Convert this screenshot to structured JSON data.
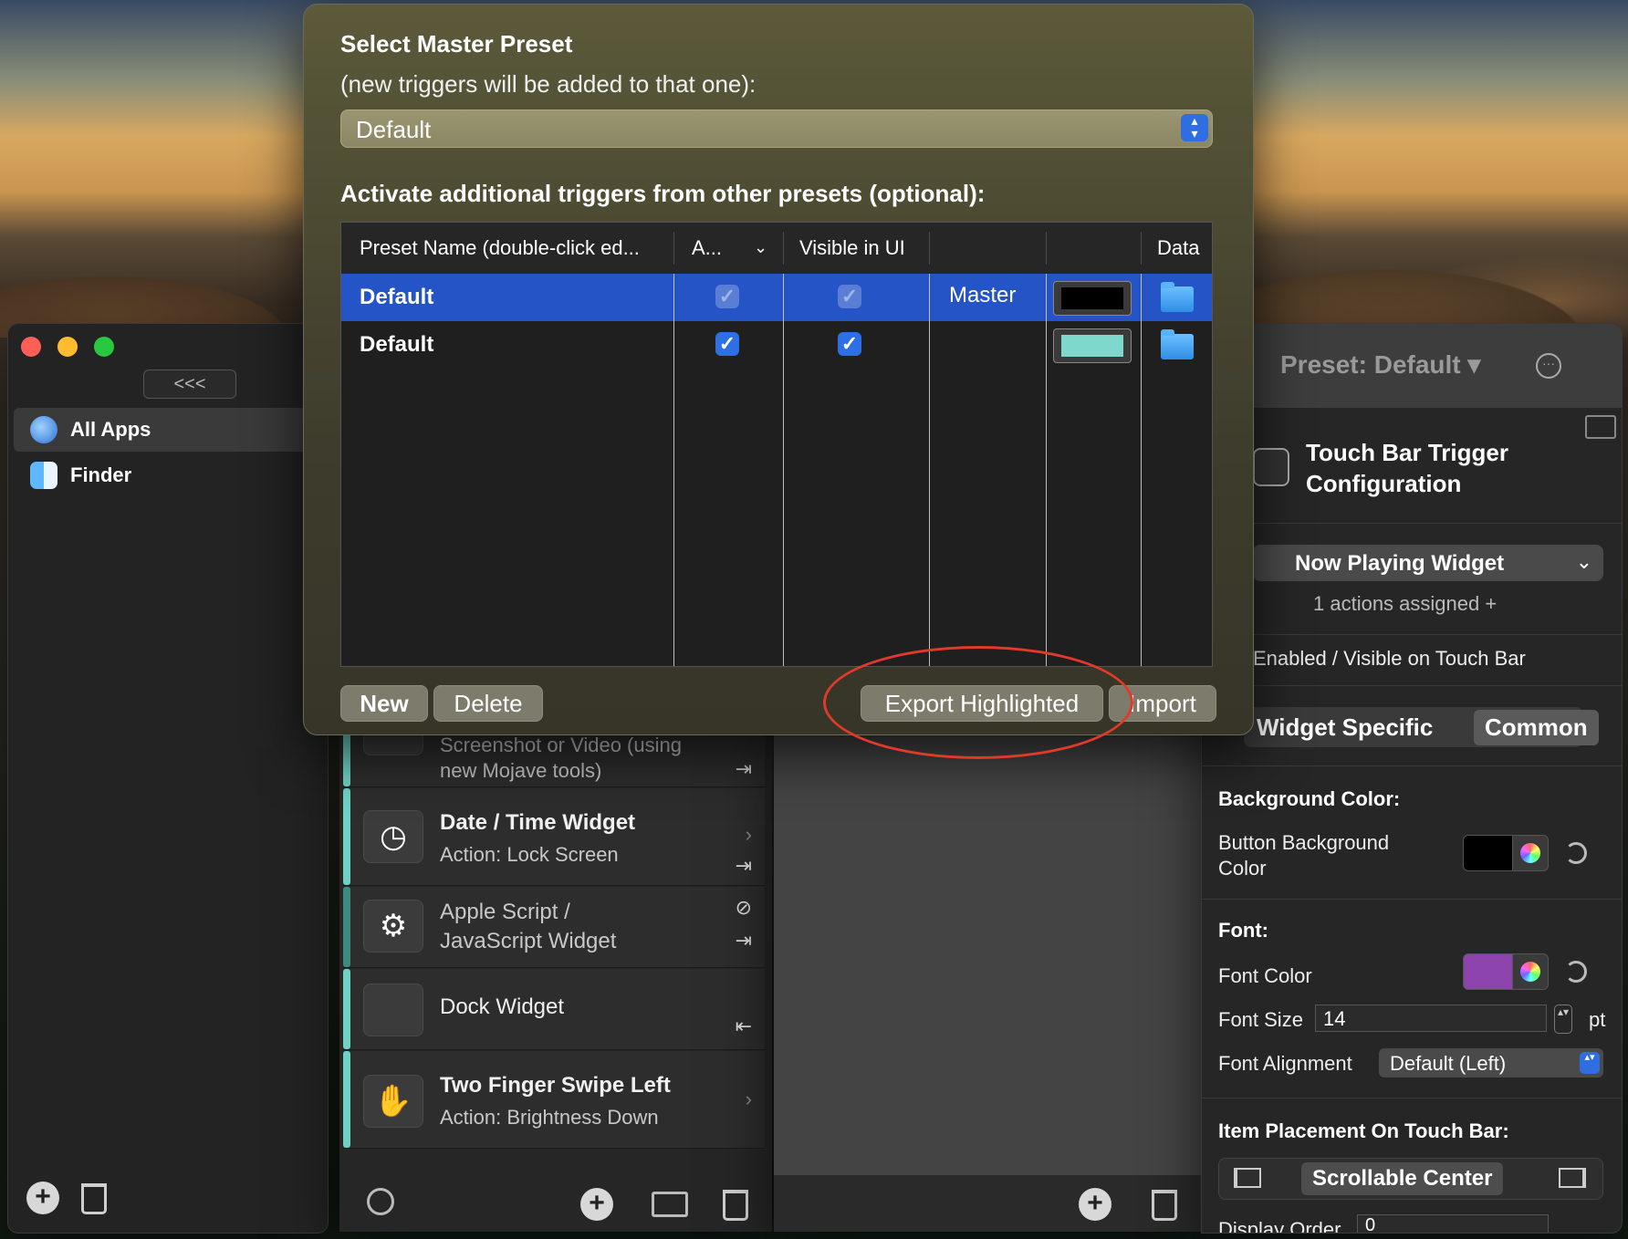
{
  "sidebar": {
    "collapse_label": "<<<",
    "items": [
      {
        "label": "All Apps",
        "icon": "globe-icon"
      },
      {
        "label": "Finder",
        "icon": "finder-icon"
      }
    ]
  },
  "triggers": [
    {
      "title": "Screenshot or Video (using",
      "subtitle": "new Mojave tools)",
      "icon": "camera-icon"
    },
    {
      "title": "Date / Time Widget",
      "subtitle": "Action: Lock Screen",
      "icon": "clock-icon"
    },
    {
      "title": "Apple Script /",
      "subtitle": "JavaScript Widget",
      "icon": "gear-icon"
    },
    {
      "title": "Dock Widget",
      "subtitle": "",
      "icon": "dock-icon"
    },
    {
      "title": "Two Finger Swipe Left",
      "subtitle": "Action: Brightness Down",
      "icon": "hand-icon"
    }
  ],
  "inspector": {
    "preset_label": "Preset: Default",
    "config_title_1": "Touch Bar Trigger",
    "config_title_2": "Configuration",
    "trigger_type": "Now Playing Widget",
    "actions_assigned": "1 actions assigned +",
    "enabled_label": "Enabled / Visible on Touch Bar",
    "tab_widget": "Widget Specific",
    "tab_common": "Common",
    "bg_section": "Background Color:",
    "bg_label_1": "Button Background",
    "bg_label_2": "Color",
    "bg_color": "#000000",
    "font_section": "Font:",
    "font_color_label": "Font Color",
    "font_color": "#8e44ad",
    "font_size_label": "Font Size",
    "font_size_value": "14",
    "font_size_unit": "pt",
    "font_alignment_label": "Font Alignment",
    "font_alignment_value": "Default (Left)",
    "placement_section": "Item Placement On Touch Bar:",
    "placement_value": "Scrollable Center",
    "display_order_label": "Display Order",
    "display_order_value": "0"
  },
  "sheet": {
    "title": "Select Master Preset",
    "subtitle": "(new triggers will be added to that one):",
    "master_preset": "Default",
    "additional_label": "Activate additional triggers from other presets (optional):",
    "columns": [
      "Preset Name (double-click ed...",
      "A...",
      "Visible in UI",
      "",
      "",
      "Data"
    ],
    "rows": [
      {
        "name": "Default",
        "active": true,
        "visible": true,
        "role": "Master",
        "color": "#000000",
        "selected": true
      },
      {
        "name": "Default",
        "active": true,
        "visible": true,
        "role": "",
        "color": "#7fd8cc",
        "selected": false
      }
    ],
    "btn_new": "New",
    "btn_delete": "Delete",
    "btn_export": "Export Highlighted",
    "btn_import": "Import"
  },
  "colors": {
    "accent": "#2554c7",
    "annotation": "#e03a2a",
    "trigger_bar": "#6fd2c4"
  }
}
